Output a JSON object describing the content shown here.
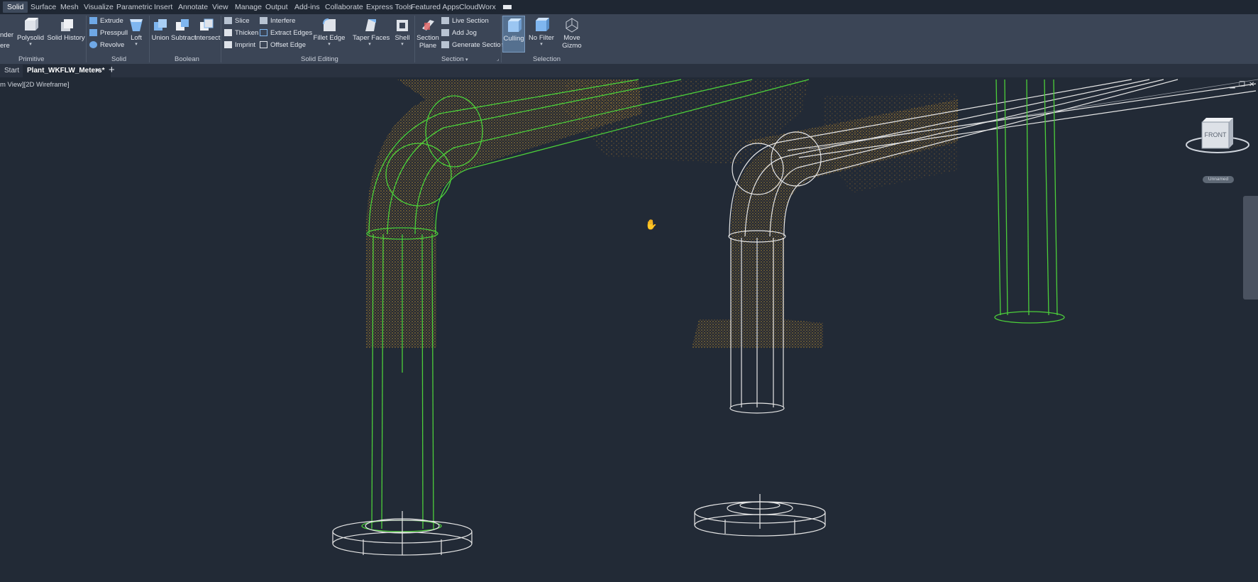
{
  "menu": {
    "tabs": [
      "Solid",
      "Surface",
      "Mesh",
      "Visualize",
      "Parametric",
      "Insert",
      "Annotate",
      "View",
      "Manage",
      "Output",
      "Add-ins",
      "Collaborate",
      "Express Tools",
      "Featured Apps",
      "CloudWorx"
    ],
    "active_tab": "Solid"
  },
  "ribbon": {
    "primitive": {
      "cut_labels": [
        "nder",
        "ere"
      ],
      "polysolid": "Polysolid",
      "solid_history": "Solid History",
      "panel": "Primitive"
    },
    "solid": {
      "extrude": "Extrude",
      "presspull": "Presspull",
      "revolve": "Revolve",
      "loft": "Loft",
      "panel": "Solid"
    },
    "boolean": {
      "union": "Union",
      "subtract": "Subtract",
      "intersect": "Intersect",
      "panel": "Boolean"
    },
    "solid_editing": {
      "slice": "Slice",
      "thicken": "Thicken",
      "imprint": "Imprint",
      "interfere": "Interfere",
      "extract_edges": "Extract Edges",
      "offset_edge": "Offset Edge",
      "fillet_edge": "Fillet Edge",
      "taper_faces": "Taper Faces",
      "shell": "Shell",
      "panel": "Solid Editing"
    },
    "section": {
      "section_plane_1": "Section",
      "section_plane_2": "Plane",
      "live_section": "Live Section",
      "add_jog": "Add Jog",
      "generate_section": "Generate Section",
      "panel": "Section"
    },
    "selection": {
      "culling": "Culling",
      "no_filter": "No Filter",
      "move_gizmo_1": "Move",
      "move_gizmo_2": "Gizmo",
      "panel": "Selection"
    }
  },
  "doc_tabs": {
    "start": "Start",
    "active": "Plant_WKFLW_Meters*"
  },
  "viewport": {
    "label": "m View][2D Wireframe]",
    "viewcube_face": "FRONT",
    "unnamed_ucs": "Unnamed"
  },
  "colors": {
    "background": "#222a36",
    "ribbon": "#3b4556",
    "pipe_green": "#4ccf3a",
    "pipe_white": "#e6e6e6",
    "point_cloud": "#d49a2a"
  },
  "icons": [
    "hand-cursor-icon",
    "viewcube-icon",
    "close-icon",
    "add-tab-icon"
  ]
}
